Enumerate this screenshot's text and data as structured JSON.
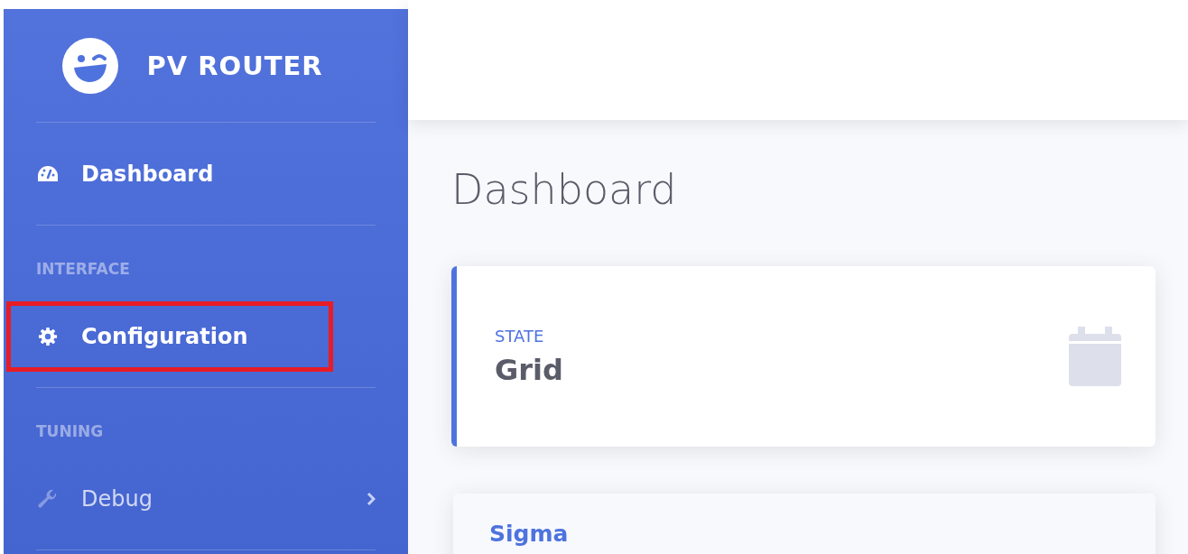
{
  "sidebar": {
    "brand": "PV ROUTER",
    "items": [
      {
        "kind": "link",
        "label": "Dashboard",
        "active": true,
        "highlighted": false,
        "expandable": false
      },
      {
        "kind": "heading",
        "label": "INTERFACE"
      },
      {
        "kind": "link",
        "label": "Configuration",
        "active": true,
        "highlighted": true,
        "expandable": false
      },
      {
        "kind": "heading",
        "label": "TUNING"
      },
      {
        "kind": "link",
        "label": "Debug",
        "active": false,
        "highlighted": false,
        "expandable": true
      }
    ]
  },
  "page": {
    "title": "Dashboard",
    "state_card": {
      "label": "STATE",
      "value": "Grid"
    },
    "panel": {
      "title": "Sigma"
    }
  }
}
